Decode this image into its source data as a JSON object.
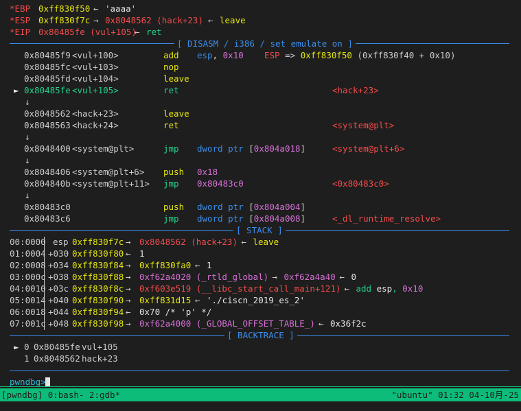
{
  "registers": [
    {
      "name": "*EBP",
      "addr": "0xff830f50",
      "arrow": "←",
      "extra": "'aaaa'",
      "extra_color": "wht"
    },
    {
      "name": "*ESP",
      "addr": "0xff830f7c",
      "arrow": "→",
      "target": "0x8048562 (hack+23)",
      "arrow2": "←",
      "extra": "leave",
      "extra_color": "yel"
    },
    {
      "name": "*EIP",
      "addr": "0x80485fe (vul+105)",
      "arrow": "←",
      "extra": "ret",
      "extra_color": "grn"
    }
  ],
  "headers": {
    "disasm": "[ DISASM / i386 / set emulate on ]",
    "stack": "[ STACK ]",
    "backtrace": "[ BACKTRACE ]"
  },
  "disasm": [
    {
      "addr": "0x80485f9",
      "sym": "<vul+100>",
      "mn": "add",
      "op": "esp, 0x10",
      "note": "ESP => 0xff830f50 (0xff830f40 + 0x10)",
      "cur": false,
      "jmp": false
    },
    {
      "addr": "0x80485fc",
      "sym": "<vul+103>",
      "mn": "nop",
      "op": "",
      "note": "",
      "cur": false,
      "jmp": false
    },
    {
      "addr": "0x80485fd",
      "sym": "<vul+104>",
      "mn": "leave",
      "op": "",
      "note": "",
      "cur": false,
      "jmp": false
    },
    {
      "addr": "0x80485fe",
      "sym": "<vul+105>",
      "mn": "ret",
      "op": "",
      "note": "<hack+23>",
      "cur": true,
      "jmp": false
    },
    {
      "addr": "0x8048562",
      "sym": "<hack+23>",
      "mn": "leave",
      "op": "",
      "note": "",
      "cur": false,
      "jmp": false
    },
    {
      "addr": "0x8048563",
      "sym": "<hack+24>",
      "mn": "ret",
      "op": "",
      "note": "<system@plt>",
      "cur": false,
      "jmp": false
    },
    {
      "addr": "0x8048400",
      "sym": "<system@plt>",
      "mn": "jmp",
      "op": "dword ptr [0x804a018]",
      "note": "<system@plt+6>",
      "cur": false,
      "jmp": true
    },
    {
      "addr": "0x8048406",
      "sym": "<system@plt+6>",
      "mn": "push",
      "op": "0x18",
      "note": "",
      "cur": false,
      "jmp": false
    },
    {
      "addr": "0x804840b",
      "sym": "<system@plt+11>",
      "mn": "jmp",
      "op": "0x80483c0",
      "note": "<0x80483c0>",
      "cur": false,
      "jmp": true
    },
    {
      "addr": "0x80483c0",
      "sym": "",
      "mn": "push",
      "op": "dword ptr [0x804a004]",
      "note": "",
      "cur": false,
      "jmp": false
    },
    {
      "addr": "0x80483c6",
      "sym": "",
      "mn": "jmp",
      "op": "dword ptr [0x804a008]",
      "note": "<_dl_runtime_resolve>",
      "cur": false,
      "jmp": true
    }
  ],
  "down_arrow": "↓",
  "cur_marker": "►",
  "stack": [
    {
      "idx": "00:0000",
      "off": "esp",
      "addr": "0xff830f7c",
      "chain": "0x8048562 (hack+23)",
      "chain_color": "red",
      "tail": "leave",
      "tail_color": "yel"
    },
    {
      "idx": "01:0004",
      "off": "+030",
      "addr": "0xff830f80",
      "chain": "",
      "chain_color": "",
      "tail": "1",
      "tail_color": "wht"
    },
    {
      "idx": "02:0008",
      "off": "+034",
      "addr": "0xff830f84",
      "chain": "0xff830fa0",
      "chain_color": "yel",
      "tail": "1",
      "tail_color": "wht"
    },
    {
      "idx": "03:000c",
      "off": "+038",
      "addr": "0xff830f88",
      "chain": "0xf62a4020 (_rtld_global)",
      "chain_color": "mag",
      "chain2": "0xf62a4a40",
      "tail": "0",
      "tail_color": "wht"
    },
    {
      "idx": "04:0010",
      "off": "+03c",
      "addr": "0xff830f8c",
      "chain": "0xf603e519 (__libc_start_call_main+121)",
      "chain_color": "red",
      "tail": "add esp, 0x10",
      "tail_color": "grn"
    },
    {
      "idx": "05:0014",
      "off": "+040",
      "addr": "0xff830f90",
      "chain": "0xff831d15",
      "chain_color": "yel",
      "tail": "'./ciscn_2019_es_2'",
      "tail_color": "wht"
    },
    {
      "idx": "06:0018",
      "off": "+044",
      "addr": "0xff830f94",
      "chain": "",
      "chain_color": "",
      "tail": "0x70 /* 'p' */",
      "tail_color": "wht"
    },
    {
      "idx": "07:001c",
      "off": "+048",
      "addr": "0xff830f98",
      "chain": "0xf62a4000 (_GLOBAL_OFFSET_TABLE_)",
      "chain_color": "mag",
      "tail": "0x36f2c",
      "tail_color": "wht"
    }
  ],
  "backtrace": [
    {
      "marker": "►",
      "n": "0",
      "addr": "0x80485fe",
      "fn": "vul+105"
    },
    {
      "marker": "",
      "n": "1",
      "addr": "0x8048562",
      "fn": "hack+23"
    }
  ],
  "prompt": "pwndbg>",
  "status": {
    "left": "[pwndbg] 0:bash- 2:gdb*",
    "right": "\"ubuntu\" 01:32 04-10月-25"
  },
  "colors": {
    "bg": "#1e1e1e",
    "status_bg": "#0dbc79",
    "rule": "#3b8eea"
  }
}
